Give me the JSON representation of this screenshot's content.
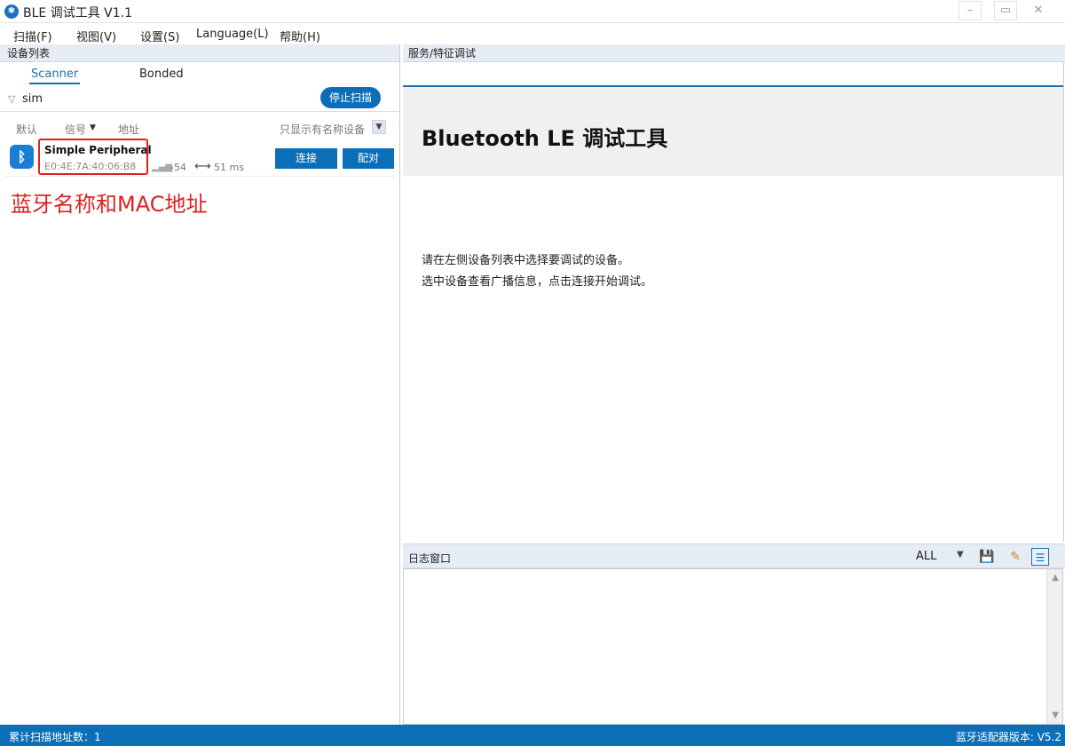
{
  "window": {
    "title": "BLE 调试工具 V1.1",
    "app_icon": "bluetooth-icon"
  },
  "menu": [
    "扫描(F)",
    "视图(V)",
    "设置(S)",
    "Language(L)",
    "帮助(H)"
  ],
  "device_panel": {
    "header": "设备列表",
    "tabs": [
      "Scanner",
      "Bonded"
    ],
    "active_tab": "Scanner",
    "filter_value": "sim",
    "stop_scan_label": "停止扫描",
    "sort_default": "默认",
    "sort_signal": "信号",
    "sort_address": "地址",
    "only_named_label": "只显示有名称设备",
    "devices": [
      {
        "name": "Simple Peripheral",
        "mac": "E0:4E:7A:40:06:B8",
        "rssi": "-54",
        "interval": "51 ms",
        "connect_label": "连接",
        "pair_label": "配对"
      }
    ],
    "annotation": "蓝牙名称和MAC地址"
  },
  "service_panel": {
    "header": "服务/特征调试",
    "hero_title": "Bluetooth LE 调试工具",
    "instruction_1": "请在左侧设备列表中选择要调试的设备。",
    "instruction_2": "选中设备查看广播信息，点击连接开始调试。"
  },
  "log_panel": {
    "title": "日志窗口",
    "level": "ALL"
  },
  "status": {
    "left": "累计扫描地址数：1",
    "right": "蓝牙适配器版本: V5.2"
  },
  "colors": {
    "accent": "#0b6fb8",
    "annotation": "#e02020"
  }
}
